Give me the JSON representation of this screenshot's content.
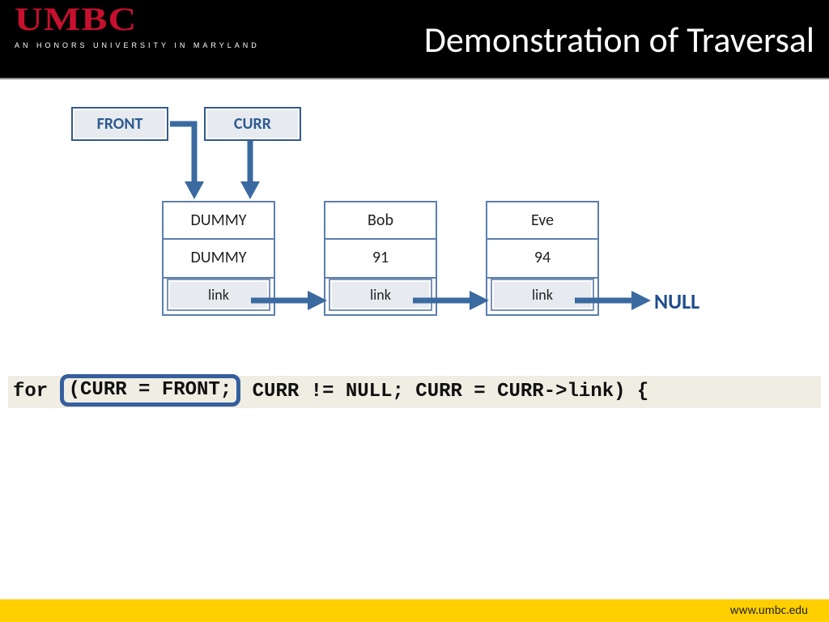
{
  "header": {
    "logo_main": "UMBC",
    "logo_sub": "AN HONORS UNIVERSITY IN MARYLAND",
    "title": "Demonstration of Traversal"
  },
  "pointers": {
    "front": "FRONT",
    "curr": "CURR"
  },
  "nodes": [
    {
      "name": "DUMMY",
      "val": "DUMMY",
      "link": "link"
    },
    {
      "name": "Bob",
      "val": "91",
      "link": "link"
    },
    {
      "name": "Eve",
      "val": "94",
      "link": "link"
    }
  ],
  "null_label": "NULL",
  "code": {
    "pre": "for ",
    "hi": "(CURR = FRONT;",
    "post": " CURR != NULL; CURR = CURR->link) {"
  },
  "footer": {
    "url": "www.umbc.edu"
  }
}
